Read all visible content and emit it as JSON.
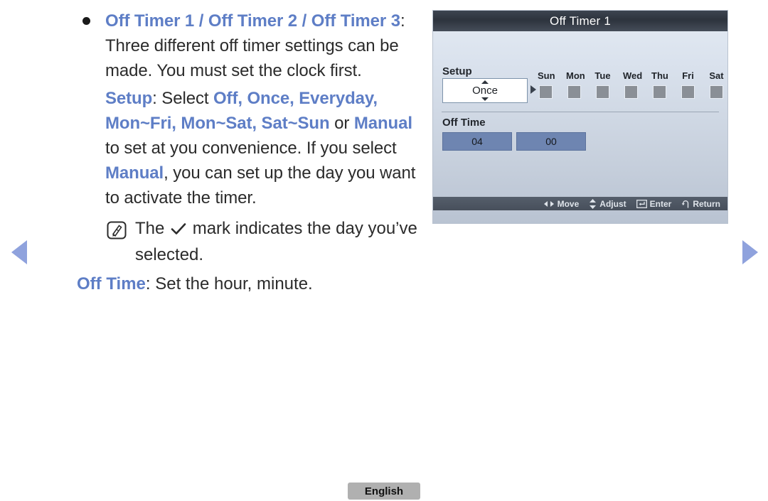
{
  "page": {
    "language_button": "English"
  },
  "nav": {
    "prev_label": "Previous page",
    "next_label": "Next page"
  },
  "content": {
    "heading": {
      "timer1": "Off Timer 1",
      "sep1": " / ",
      "timer2": "Off Timer 2",
      "sep2": " / ",
      "timer3": "Off Timer 3",
      "colon": ":"
    },
    "paragraph1": "Three different off timer settings can be made. You must set the clock first.",
    "setup_line": {
      "setup": "Setup",
      "select": ": Select ",
      "options": "Off, Once, Everyday, Mon~Fri, Mon~Sat, Sat~Sun",
      "or": " or ",
      "manual": "Manual",
      "tail": " to set at you convenience. If you select ",
      "manual2": "Manual",
      "tail2": ", you can set up the day you want to activate the timer."
    },
    "note": {
      "prefix": "The ",
      "suffix": " mark indicates the day you’ve selected."
    },
    "offtime_line": {
      "label": "Off Time",
      "text": ": Set the hour, minute."
    }
  },
  "osd": {
    "title": "Off Timer 1",
    "setup_label": "Setup",
    "setup_value": "Once",
    "days": [
      {
        "name": "Sun",
        "checked": false
      },
      {
        "name": "Mon",
        "checked": false
      },
      {
        "name": "Tue",
        "checked": false
      },
      {
        "name": "Wed",
        "checked": false
      },
      {
        "name": "Thu",
        "checked": false
      },
      {
        "name": "Fri",
        "checked": false
      },
      {
        "name": "Sat",
        "checked": false
      }
    ],
    "offtime_label": "Off Time",
    "hour": "04",
    "minute": "00",
    "footer": {
      "move": "Move",
      "adjust": "Adjust",
      "enter": "Enter",
      "return": "Return"
    }
  },
  "colors": {
    "accent_blue": "#5e7ec6",
    "nav_arrow": "#8fa2dd",
    "osd_header": "#2d333d",
    "time_box": "#6e85b1"
  }
}
